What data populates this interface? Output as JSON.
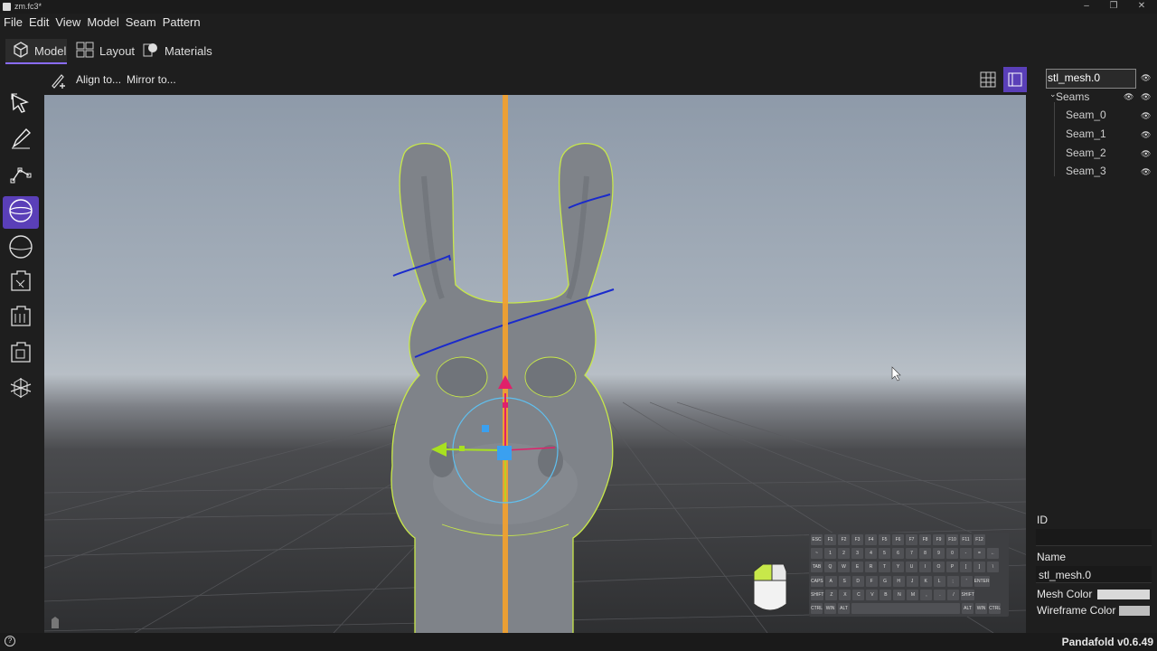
{
  "window": {
    "title": "zm.fc3*"
  },
  "menu": [
    "File",
    "Edit",
    "View",
    "Model",
    "Seam",
    "Pattern"
  ],
  "mode_tabs": [
    {
      "label": "Model",
      "active": true
    },
    {
      "label": "Layout",
      "active": false
    },
    {
      "label": "Materials",
      "active": false
    }
  ],
  "toolbar": {
    "align_label": "Align to...",
    "mirror_label": "Mirror to..."
  },
  "left_tools": [
    {
      "icon": "select-arrow-icon",
      "active": false
    },
    {
      "icon": "pen-icon",
      "active": false
    },
    {
      "icon": "path-edit-icon",
      "active": false
    },
    {
      "icon": "sphere-seam-icon",
      "active": true
    },
    {
      "icon": "sphere-icon",
      "active": false
    },
    {
      "icon": "pattern-piece-a-icon",
      "active": false
    },
    {
      "icon": "pattern-piece-b-icon",
      "active": false
    },
    {
      "icon": "pattern-piece-c-icon",
      "active": false
    },
    {
      "icon": "transform-gizmo-icon",
      "active": false
    }
  ],
  "scene_tree": {
    "root": {
      "label": "stl_mesh.0"
    },
    "group": {
      "label": "Seams"
    },
    "seams": [
      "Seam_0",
      "Seam_1",
      "Seam_2",
      "Seam_3"
    ]
  },
  "properties": {
    "id_label": "ID",
    "id_value": "",
    "name_label": "Name",
    "name_value": "stl_mesh.0",
    "mesh_color_label": "Mesh Color",
    "wireframe_color_label": "Wireframe Color",
    "mesh_color": "#d9d9d9",
    "wireframe_color": "#bdbdbd"
  },
  "keyboard_rows": [
    [
      "ESC",
      "F1",
      "F2",
      "F3",
      "F4",
      "F5",
      "F6",
      "F7",
      "F8",
      "F9",
      "F10",
      "F11",
      "F12"
    ],
    [
      "~",
      "1",
      "2",
      "3",
      "4",
      "5",
      "6",
      "7",
      "8",
      "9",
      "0",
      "-",
      "=",
      "←"
    ],
    [
      "TAB",
      "Q",
      "W",
      "E",
      "R",
      "T",
      "Y",
      "U",
      "I",
      "O",
      "P",
      "[",
      "]",
      "\\"
    ],
    [
      "CAPS",
      "A",
      "S",
      "D",
      "F",
      "G",
      "H",
      "J",
      "K",
      "L",
      ";",
      "'",
      "ENTER"
    ],
    [
      "SHIFT",
      "Z",
      "X",
      "C",
      "V",
      "B",
      "N",
      "M",
      ",",
      ".",
      "/",
      "SHIFT"
    ],
    [
      "CTRL",
      "WIN",
      "ALT",
      "",
      "ALT",
      "WIN",
      "CTRL"
    ]
  ],
  "status": {
    "version": "Pandafold v0.6.49"
  },
  "colors": {
    "accent": "#5a3fb8",
    "gizmo_axis": "#f0a030",
    "seam": "#1a2acc",
    "outline": "#c8e84a"
  }
}
